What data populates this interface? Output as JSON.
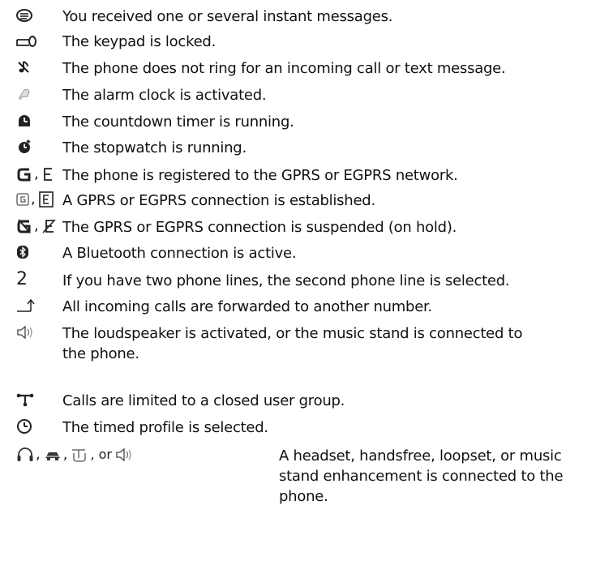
{
  "indicators": [
    {
      "icons": [
        "instant-message-icon"
      ],
      "description": "You received one or several instant messages."
    },
    {
      "icons": [
        "keypad-lock-icon"
      ],
      "description": "The keypad is locked."
    },
    {
      "icons": [
        "silent-icon"
      ],
      "description": "The phone does not ring for an incoming call or text message."
    },
    {
      "icons": [
        "alarm-clock-icon"
      ],
      "description": "The alarm clock is activated."
    },
    {
      "icons": [
        "countdown-timer-icon"
      ],
      "description": "The countdown timer is running."
    },
    {
      "icons": [
        "stopwatch-icon"
      ],
      "description": "The stopwatch is running."
    },
    {
      "icons": [
        "gprs-registered-icon",
        "egprs-registered-icon"
      ],
      "separators": [
        ","
      ],
      "description": "The phone is registered to the GPRS or EGPRS network."
    },
    {
      "icons": [
        "gprs-connected-icon",
        "egprs-connected-icon"
      ],
      "separators": [
        ","
      ],
      "description": "A GPRS or EGPRS connection is established."
    },
    {
      "icons": [
        "gprs-suspended-icon",
        "egprs-suspended-icon"
      ],
      "separators": [
        ","
      ],
      "description": "The GPRS or EGPRS connection is suspended (on hold)."
    },
    {
      "icons": [
        "bluetooth-icon"
      ],
      "description": "A Bluetooth connection is active."
    },
    {
      "icons": [
        "second-line-icon"
      ],
      "glyph": "2",
      "description": "If you have two phone lines, the second phone line is selected."
    },
    {
      "icons": [
        "call-forward-icon"
      ],
      "description": "All incoming calls are forwarded to another number."
    },
    {
      "icons": [
        "loudspeaker-icon"
      ],
      "description": "The loudspeaker is activated, or the music stand is connected to the phone."
    },
    {
      "icons": [
        "closed-user-group-icon"
      ],
      "description": "Calls are limited to a closed user group."
    },
    {
      "icons": [
        "timed-profile-icon"
      ],
      "description": "The timed profile is selected."
    },
    {
      "icons": [
        "headset-icon",
        "handsfree-icon",
        "loopset-icon",
        "music-stand-icon"
      ],
      "separators": [
        ",",
        ",",
        ", or"
      ],
      "description": "A headset, handsfree, loopset, or music stand enhancement is connected to the phone."
    }
  ]
}
